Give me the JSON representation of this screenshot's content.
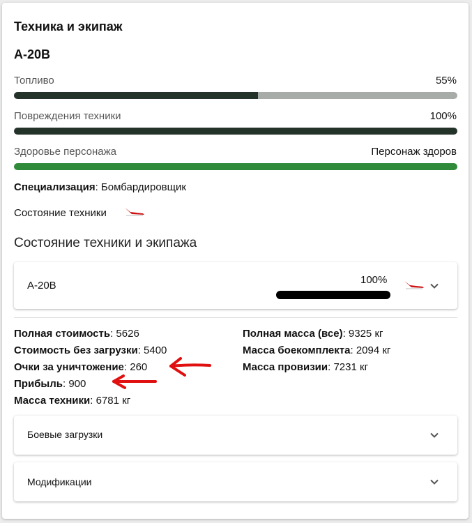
{
  "card": {
    "title": "Техника и экипаж",
    "vehicle": "А-20В"
  },
  "bars": [
    {
      "label": "Топливо",
      "value_text": "55%",
      "level": 0.55
    },
    {
      "label": "Повреждения техники",
      "value_text": "100%",
      "level": 1.0
    },
    {
      "label": "Здоровье персонажа",
      "value_text": "Персонаж здоров",
      "level": 1.0
    }
  ],
  "specialization": {
    "label": "Специализация",
    "value": "Бомбардировщик"
  },
  "vehicle_state_label": "Состояние техники",
  "crew_section": {
    "title": "Состояние техники и экипажа",
    "row": {
      "name": "А-20В",
      "percent": "100%"
    }
  },
  "stats_left": [
    {
      "label": "Полная стоимость",
      "value": "5626"
    },
    {
      "label": "Стоимость без загрузки",
      "value": "5400"
    },
    {
      "label": "Очки за уничтожение",
      "value": "260"
    },
    {
      "label": "Прибыль",
      "value": "900"
    },
    {
      "label": "Масса техники",
      "value": "6781 кг"
    }
  ],
  "stats_right": [
    {
      "label": "Полная масса (все)",
      "value": "9325 кг"
    },
    {
      "label": "Масса боекомплекта",
      "value": "2094 кг"
    },
    {
      "label": "Масса провизии",
      "value": "7231 кг"
    }
  ],
  "accordions": [
    {
      "label": "Боевые загрузки"
    },
    {
      "label": "Модификации"
    }
  ],
  "colors": {
    "bar_dark": "#243329",
    "bar_track": "#a8aca9",
    "bar_green": "#2f8a3a",
    "annotation_red": "#e01010"
  }
}
